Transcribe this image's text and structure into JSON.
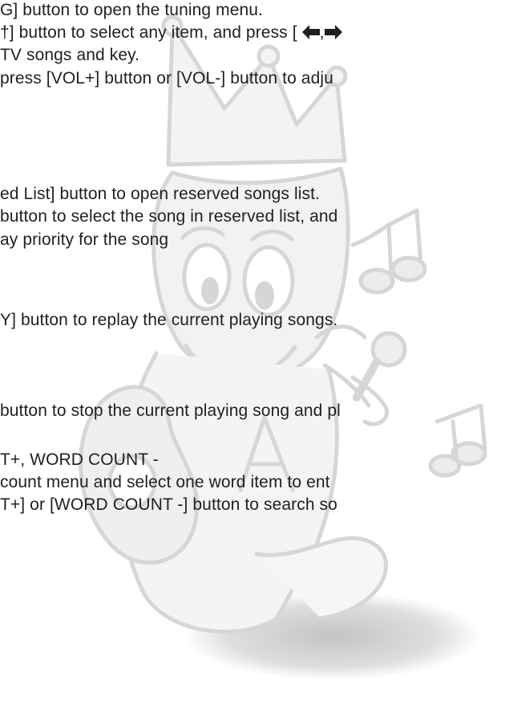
{
  "document": {
    "lines": [
      "G] button to open the tuning menu.",
      "†] button to select any item, and press [",
      "TV songs and key.",
      " press [VOL+] button or [VOL-] button to adju",
      "ed List] button to open reserved songs list.",
      "button to select the song in reserved list, and",
      "ay priority for the song",
      "Y] button to replay the current playing songs.",
      "button to stop the current playing song and pl",
      "T+, WORD COUNT -",
      " count menu and select one word item to ent",
      "T+] or [WORD COUNT -] button to search so"
    ],
    "arrow_separator": ",",
    "icons": {
      "left_arrow": "left-arrow-icon",
      "right_arrow": "right-arrow-icon"
    }
  },
  "watermark": {
    "description_icon": "karaoke-mascot-watermark",
    "color": "#d9d9d9"
  }
}
